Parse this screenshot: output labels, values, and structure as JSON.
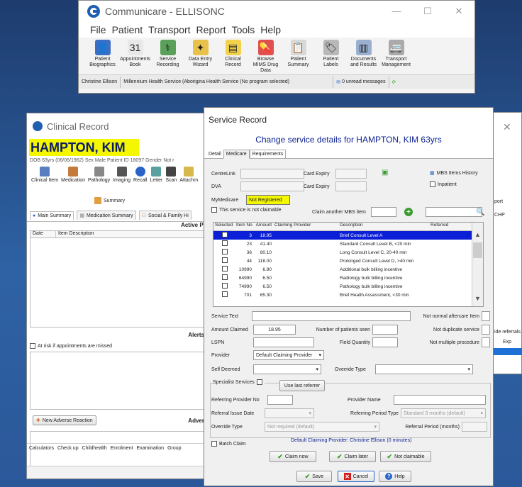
{
  "main_window": {
    "title": "Communicare - ELLISONC",
    "controls": [
      "—",
      "☐",
      "✕"
    ],
    "menu": [
      "File",
      "Patient",
      "Transport",
      "Report",
      "Tools",
      "Help"
    ],
    "toolbar": [
      {
        "icon": "person-icon",
        "glyph": "👤",
        "color": "#3a6fc4",
        "label": "Patient Biographics"
      },
      {
        "icon": "calendar-icon",
        "glyph": "31",
        "color": "#e8e8e8",
        "label": "Appointments Book"
      },
      {
        "icon": "service-recording-icon",
        "glyph": "⚕",
        "color": "#5aa05a",
        "label": "Service Recording"
      },
      {
        "icon": "wizard-icon",
        "glyph": "✦",
        "color": "#e8c14a",
        "label": "Data Entry Wizard"
      },
      {
        "icon": "clinical-record-icon",
        "glyph": "▤",
        "color": "#f2d24c",
        "label": "Clinical Record"
      },
      {
        "icon": "pill-icon",
        "glyph": "💊",
        "color": "#e05050",
        "label": "Browse MIMS Drug Data"
      },
      {
        "icon": "summary-icon",
        "glyph": "📋",
        "color": "#d8d8d8",
        "label": "Patient Summary"
      },
      {
        "icon": "labels-icon",
        "glyph": "🏷",
        "color": "#b8b8b8",
        "label": "Patient Labels"
      },
      {
        "icon": "documents-icon",
        "glyph": "▥",
        "color": "#9ab0d0",
        "label": "Documents and Results"
      },
      {
        "icon": "transport-icon",
        "glyph": "🚐",
        "color": "#aaaaaa",
        "label": "Transport Management"
      }
    ],
    "status": {
      "user": "Christine Ellison",
      "service": "Millennium Health Service (Aborigina Health Service (No program selected)",
      "messages_count": "0",
      "messages": "unread messages"
    }
  },
  "clinical_record": {
    "title": "Clinical Record",
    "patient_name": "HAMPTON, KIM",
    "demographics": "DOB 63yrs (06/06/1962) Sex Male Patient ID 18097 Gender Not r",
    "tools": [
      "Clinical Item",
      "Medication",
      "Pathology",
      "Imaging",
      "Recall",
      "Letter",
      "Scan",
      "Attachm"
    ],
    "summary_label": "Summary",
    "tabs": [
      "Main Summary",
      "Medication Summary",
      "Social & Family Hi"
    ],
    "active_problems_header": "Active Problem/Sig",
    "grid_columns": [
      "Date",
      "Item Description"
    ],
    "alerts_header": "Alerts and Other",
    "alerts_checkbox": "At risk if appointments are missed",
    "new_adverse_button": "New Adverse Reaction",
    "adverse_header": "Adverse Reactio",
    "bottom_tabs": [
      "Calculators",
      "Check up",
      "Childhealth",
      "Enrolment",
      "Examination",
      "Group"
    ]
  },
  "right_window": {
    "close": "✕",
    "texts": [
      "port",
      "CHP",
      "ide referrals",
      "Exp"
    ]
  },
  "service_record": {
    "title": "Service Record",
    "heading": "Change service details for HAMPTON, KIM 63yrs",
    "tabs": [
      "Detail",
      "Medicare",
      "Requirements"
    ],
    "active_tab": "Medicare",
    "centrelink_label": "CentreLink",
    "dva_label": "DVA",
    "card_expiry_label": "Card Expiry",
    "mbs_history": "MBS Items History",
    "inpatient": "Inpatient",
    "mymedicare_label": "MyMedicare",
    "mymedicare_value": "Not Registered",
    "not_claimable": "This service is not claimable",
    "claim_another": "Claim another MBS item",
    "table_headers": [
      "Selected",
      "Item No",
      "Amount",
      "Claiming Provider",
      "Description",
      "Referred"
    ],
    "table_rows": [
      {
        "item": "3",
        "amount": "18.95",
        "provider": "",
        "description": "Brief Consult Level A",
        "selected": true
      },
      {
        "item": "23",
        "amount": "41.40",
        "provider": "",
        "description": "Standard Consult Level B, <20 min",
        "selected": false
      },
      {
        "item": "36",
        "amount": "80.10",
        "provider": "",
        "description": "Long Consult Level C, 20-40 min",
        "selected": false
      },
      {
        "item": "44",
        "amount": "118.00",
        "provider": "",
        "description": "Prolonged Consult Level D, >40 min",
        "selected": false
      },
      {
        "item": "10990",
        "amount": "6.90",
        "provider": "",
        "description": "Additional bulk billing incentive",
        "selected": false
      },
      {
        "item": "64990",
        "amount": "6.50",
        "provider": "",
        "description": "Radiology bulk billing incentive",
        "selected": false
      },
      {
        "item": "74990",
        "amount": "6.50",
        "provider": "",
        "description": "Pathology bulk billing incentive",
        "selected": false
      },
      {
        "item": "701",
        "amount": "65.30",
        "provider": "",
        "description": "Brief Health Assessment, <30 min",
        "selected": false
      }
    ],
    "service_text_label": "Service Text",
    "not_normal_aftercare": "Not normal aftercare Item",
    "amount_claimed_label": "Amount Claimed",
    "amount_claimed_value": "18.95",
    "patients_seen_label": "Number of patients seen",
    "not_duplicate": "Not duplicate service",
    "lspn_label": "LSPN",
    "field_quantity_label": "Field Quantity",
    "not_multiple": "Not multiple procedure",
    "provider_label": "Provider",
    "provider_value": "Default Claiming Provider",
    "self_deemed_label": "Self Deemed",
    "override_type_label": "Override Type",
    "specialist_services": "Specialist Services",
    "use_last_referrer": "Use last referrer",
    "referring_provider_no": "Referring Provider No",
    "provider_name": "Provider Name",
    "referral_issue_date": "Referral Issue Date",
    "referring_period_type": "Referring Period Type",
    "referring_period_value": "Standard 3 months (default)",
    "override_type2": "Override Type",
    "override_value": "Not required (default)",
    "referral_period_months": "Referral Period (months)",
    "batch_claim": "Batch Claim",
    "default_provider_note": "Default Claiming Provider: Christine Ellison (0 minutes)",
    "claim_now": "Claim now",
    "claim_later": "Claim later",
    "not_claimable_btn": "Not claimable",
    "save": "Save",
    "cancel": "Cancel",
    "help": "Help"
  }
}
